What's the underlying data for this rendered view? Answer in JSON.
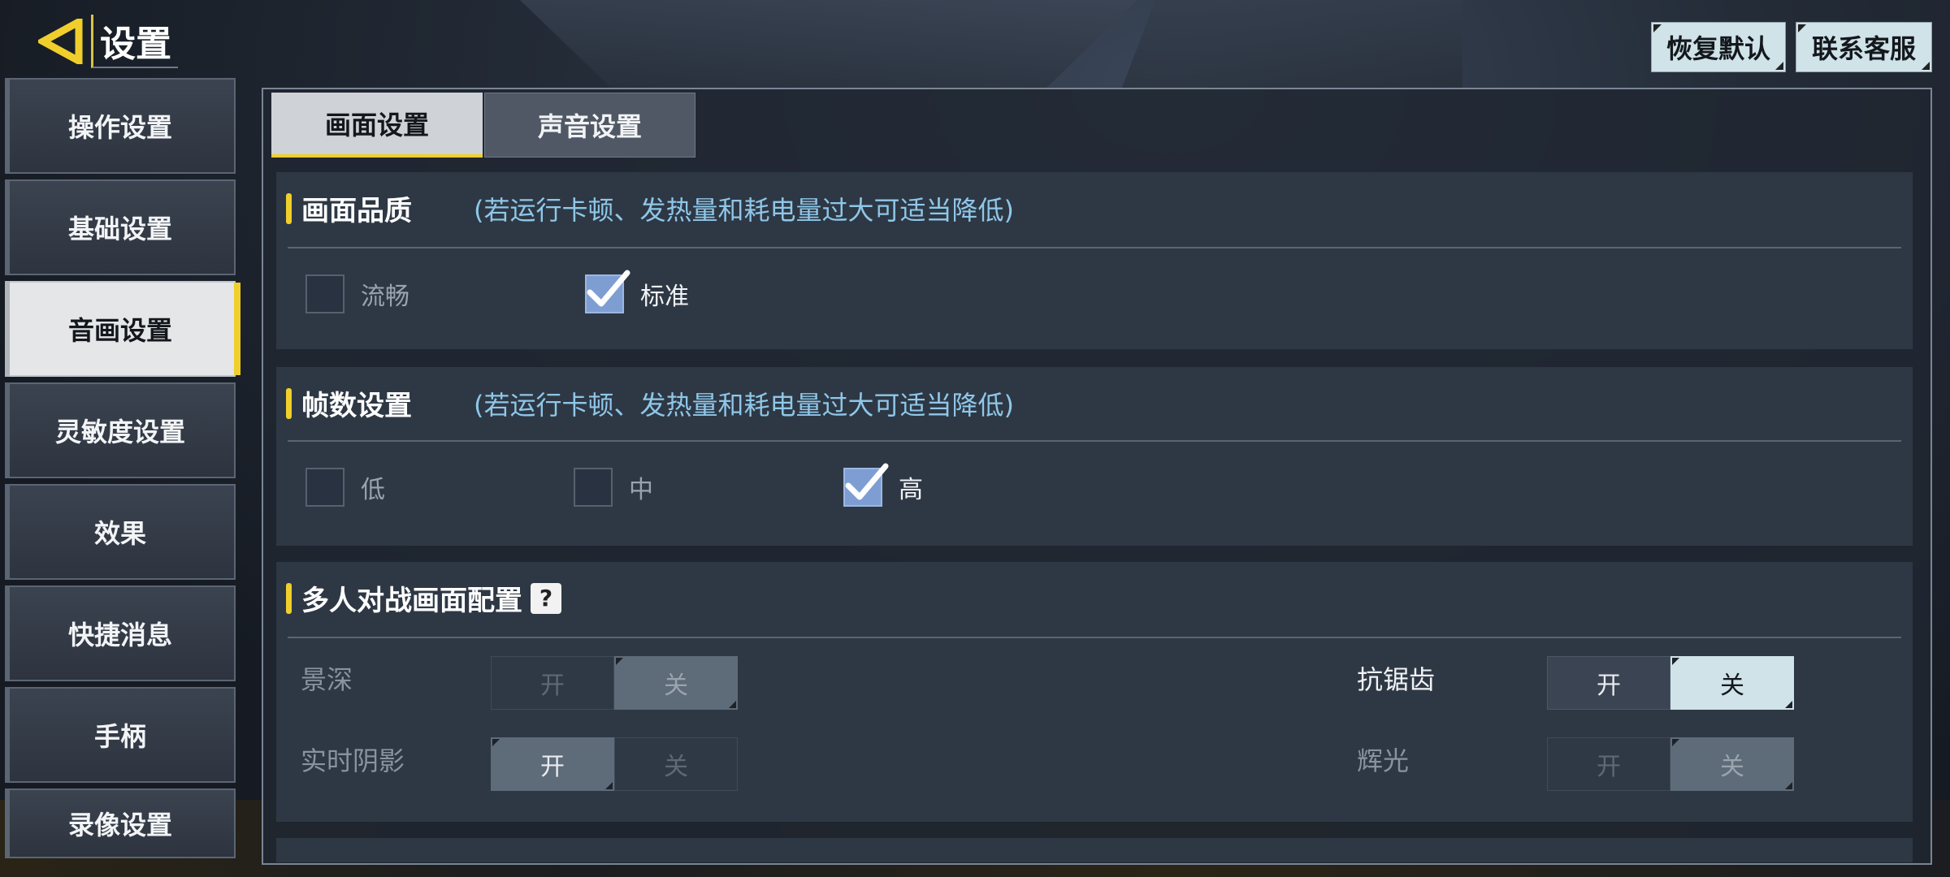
{
  "header": {
    "title": "设置",
    "restore_default": "恢复默认",
    "contact_support": "联系客服"
  },
  "sidebar": {
    "items": [
      {
        "label": "操作设置"
      },
      {
        "label": "基础设置"
      },
      {
        "label": "音画设置"
      },
      {
        "label": "灵敏度设置"
      },
      {
        "label": "效果"
      },
      {
        "label": "快捷消息"
      },
      {
        "label": "手柄"
      },
      {
        "label": "录像设置"
      }
    ],
    "active_index": 2
  },
  "tabs": [
    {
      "label": "画面设置"
    },
    {
      "label": "声音设置"
    }
  ],
  "quality": {
    "title": "画面品质",
    "hint": "(若运行卡顿、发热量和耗电量过大可适当降低)",
    "options": [
      {
        "label": "流畅",
        "checked": false
      },
      {
        "label": "标准",
        "checked": true
      }
    ]
  },
  "framerate": {
    "title": "帧数设置",
    "hint": "(若运行卡顿、发热量和耗电量过大可适当降低)",
    "options": [
      {
        "label": "低",
        "checked": false
      },
      {
        "label": "中",
        "checked": false
      },
      {
        "label": "高",
        "checked": true
      }
    ]
  },
  "multiplayer": {
    "title": "多人对战画面配置",
    "help": "?",
    "settings": {
      "depth_of_field": {
        "label": "景深",
        "on": "开",
        "off": "关",
        "value": "关"
      },
      "anti_aliasing": {
        "label": "抗锯齿",
        "on": "开",
        "off": "关",
        "value": "关"
      },
      "realtime_shadow": {
        "label": "实时阴影",
        "on": "开",
        "off": "关",
        "value": "开"
      },
      "glow": {
        "label": "辉光",
        "on": "开",
        "off": "关",
        "value": "关"
      }
    }
  },
  "colors": {
    "accent_yellow": "#f0cf2c",
    "hint_blue": "#8fc7e8",
    "checkbox_on": "#7e9ed3",
    "button_light": "#cfe3e8"
  },
  "icons": {
    "back": "back-arrow-icon",
    "check": "checkmark-icon",
    "help": "help-icon"
  }
}
